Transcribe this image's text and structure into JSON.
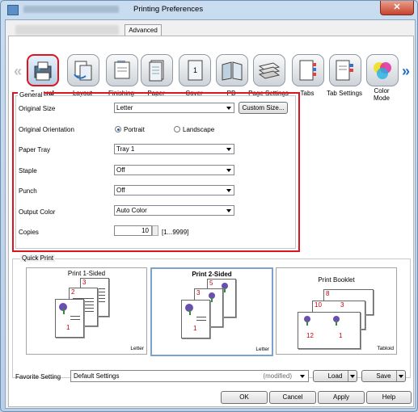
{
  "window": {
    "title": "Printing Preferences",
    "close_label": "✕"
  },
  "tabs": {
    "advanced": "Advanced"
  },
  "toolbar": {
    "items": [
      {
        "label": "General",
        "icon": "general-icon"
      },
      {
        "label": "Layout",
        "icon": "layout-icon"
      },
      {
        "label": "Finishing",
        "icon": "finishing-icon"
      },
      {
        "label": "Paper",
        "icon": "paper-icon"
      },
      {
        "label": "Cover",
        "icon": "cover-icon"
      },
      {
        "label": "PB",
        "icon": "pb-icon"
      },
      {
        "label": "Page Settings",
        "icon": "page-settings-icon"
      },
      {
        "label": "Tabs",
        "icon": "tabs-icon"
      },
      {
        "label": "Tab Settings",
        "icon": "tab-settings-icon"
      },
      {
        "label": "Color\nMode",
        "icon": "color-mode-icon"
      }
    ],
    "cover_page_number": "1"
  },
  "general": {
    "group_title": "General",
    "original_size_label": "Original Size",
    "original_size_value": "Letter",
    "custom_size_button": "Custom Size...",
    "orientation_label": "Original Orientation",
    "portrait_label": "Portrait",
    "landscape_label": "Landscape",
    "paper_tray_label": "Paper Tray",
    "paper_tray_value": "Tray 1",
    "staple_label": "Staple",
    "staple_value": "Off",
    "punch_label": "Punch",
    "punch_value": "Off",
    "output_color_label": "Output Color",
    "output_color_value": "Auto Color",
    "copies_label": "Copies",
    "copies_value": "10",
    "copies_range": "[1...9999]"
  },
  "quick_print": {
    "group_title": "Quick Print",
    "cards": [
      {
        "title": "Print 1-Sided",
        "size": "Letter",
        "pages": [
          "3",
          "2",
          "1"
        ]
      },
      {
        "title": "Print 2-Sided",
        "size": "Letter",
        "pages": [
          "5",
          "3",
          "1"
        ]
      },
      {
        "title": "Print Booklet",
        "size": "Tabloid",
        "pages": [
          "8",
          "10",
          "3",
          "12",
          "1"
        ]
      }
    ]
  },
  "favorite": {
    "label": "Favorite Setting",
    "value": "Default Settings",
    "modified": "(modified)",
    "load_button": "Load",
    "save_button": "Save"
  },
  "footer": {
    "ok": "OK",
    "cancel": "Cancel",
    "apply": "Apply",
    "help": "Help"
  }
}
